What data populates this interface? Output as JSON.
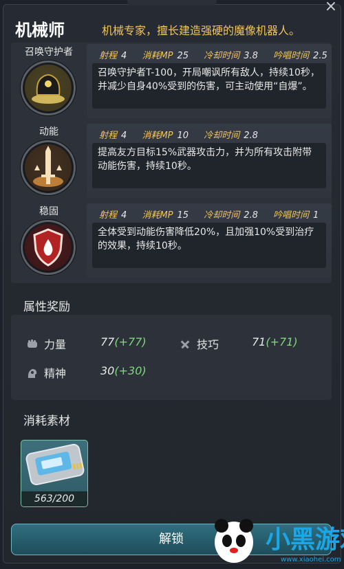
{
  "header": {
    "title": "机械师",
    "description": "机械专家，擅长建造强硬的魔像机器人。",
    "close": "×"
  },
  "skills": [
    {
      "name": "召唤守护者",
      "stats": [
        {
          "label": "射程",
          "value": "4"
        },
        {
          "label": "消耗MP",
          "value": "25"
        },
        {
          "label": "冷却时间",
          "value": "3.8"
        },
        {
          "label": "吟唱时间",
          "value": "2.5"
        }
      ],
      "description": "召唤守护者T-100，开局嘲讽所有敌人，持续10秒，并减少自身40%受到的伤害，可主动使用“自爆”。",
      "icon": "guardian-icon"
    },
    {
      "name": "动能",
      "stats": [
        {
          "label": "射程",
          "value": "4"
        },
        {
          "label": "消耗MP",
          "value": "10"
        },
        {
          "label": "冷却时间",
          "value": "2.8"
        }
      ],
      "description": "提高友方目标15%武器攻击力，并为所有攻击附带动能伤害，持续10秒。",
      "icon": "sword-icon"
    },
    {
      "name": "稳固",
      "stats": [
        {
          "label": "射程",
          "value": "4"
        },
        {
          "label": "消耗MP",
          "value": "15"
        },
        {
          "label": "冷却时间",
          "value": "2.8"
        },
        {
          "label": "吟唱时间",
          "value": "1"
        }
      ],
      "description": "全体受到动能伤害降低20%，且加强10%受到治疗的效果，持续10秒。",
      "icon": "shield-icon"
    }
  ],
  "attributes": {
    "title": "属性奖励",
    "items": [
      {
        "label": "力量",
        "base": "77",
        "bonus": "(+77)",
        "icon": "fist-icon"
      },
      {
        "label": "技巧",
        "base": "71",
        "bonus": "(+71)",
        "icon": "tools-icon"
      },
      {
        "label": "精神",
        "base": "30",
        "bonus": "(+30)",
        "icon": "head-icon"
      }
    ]
  },
  "materials": {
    "title": "消耗素材",
    "count": "563/200",
    "icon": "chip-card-icon"
  },
  "unlock_label": "解锁",
  "watermark": {
    "brand": "小黑游戏",
    "site": "www.xiaohei.com"
  },
  "colors": {
    "accent": "#f0c55a",
    "bonus": "#7ed87a",
    "button": "#2a6676"
  }
}
